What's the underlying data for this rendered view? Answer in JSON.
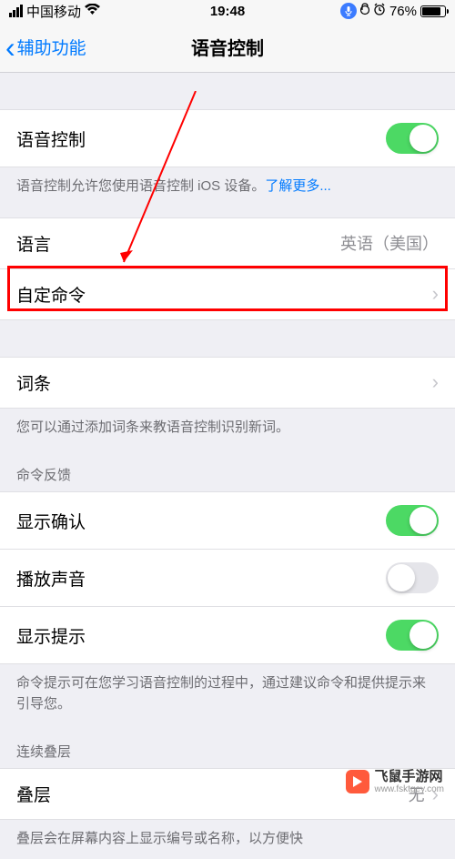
{
  "status": {
    "carrier": "中国移动",
    "time": "19:48",
    "battery_pct": "76%"
  },
  "nav": {
    "back_label": "辅助功能",
    "title": "语音控制"
  },
  "main": {
    "voice_control_label": "语音控制",
    "voice_control_desc": "语音控制允许您使用语音控制 iOS 设备。",
    "voice_control_link": "了解更多...",
    "language_label": "语言",
    "language_value": "英语（美国）",
    "custom_commands_label": "自定命令"
  },
  "vocab": {
    "label": "词条",
    "desc": "您可以通过添加词条来教语音控制识别新词。"
  },
  "feedback": {
    "header": "命令反馈",
    "show_confirm_label": "显示确认",
    "play_sound_label": "播放声音",
    "show_hint_label": "显示提示",
    "desc": "命令提示可在您学习语音控制的过程中，通过建议命令和提供提示来引导您。"
  },
  "overlay": {
    "header": "连续叠层",
    "label": "叠层",
    "value": "无",
    "desc": "叠层会在屏幕内容上显示编号或名称，以方便快"
  },
  "toggles": {
    "voice_control": true,
    "show_confirm": true,
    "play_sound": false,
    "show_hint": true
  },
  "watermark": {
    "title": "飞鼠手游网",
    "url": "www.fsktgey.com"
  }
}
